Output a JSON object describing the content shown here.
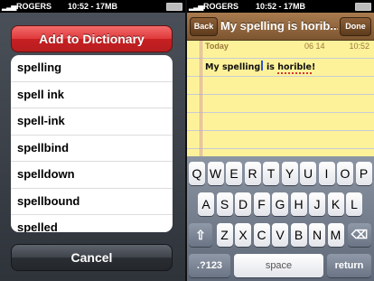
{
  "left_phone": {
    "status": {
      "carrier": "ROGERS",
      "time": "10:52 - 17MB"
    },
    "add_to_dictionary_label": "Add to Dictionary",
    "suggestions": [
      "spelling",
      "spell ink",
      "spell-ink",
      "spellbind",
      "spelldown",
      "spellbound",
      "spelled"
    ],
    "cancel_label": "Cancel"
  },
  "right_phone": {
    "status": {
      "carrier": "ROGERS",
      "time": "10:52 - 17MB"
    },
    "back_label": "Back",
    "title": "My spelling is horib...",
    "done_label": "Done",
    "date_day": "Today",
    "date": "06 14",
    "date_time": "10:52",
    "note_before_cursor": "My spelling",
    "note_middle": " is ",
    "note_misspelled": "horible",
    "note_end": "!",
    "keyboard": {
      "row1": [
        "Q",
        "W",
        "E",
        "R",
        "T",
        "Y",
        "U",
        "I",
        "O",
        "P"
      ],
      "row2": [
        "A",
        "S",
        "D",
        "F",
        "G",
        "H",
        "J",
        "K",
        "L"
      ],
      "row3": [
        "Z",
        "X",
        "C",
        "V",
        "B",
        "N",
        "M"
      ],
      "numbers_label": ".?123",
      "space_label": "space",
      "return_label": "return",
      "shift_icon": "shift-icon",
      "delete_icon": "backspace-icon"
    }
  },
  "colors": {
    "red_button": "#d6393a",
    "notes_paper": "#fdf29a",
    "nav_brown": "#7c5530"
  }
}
